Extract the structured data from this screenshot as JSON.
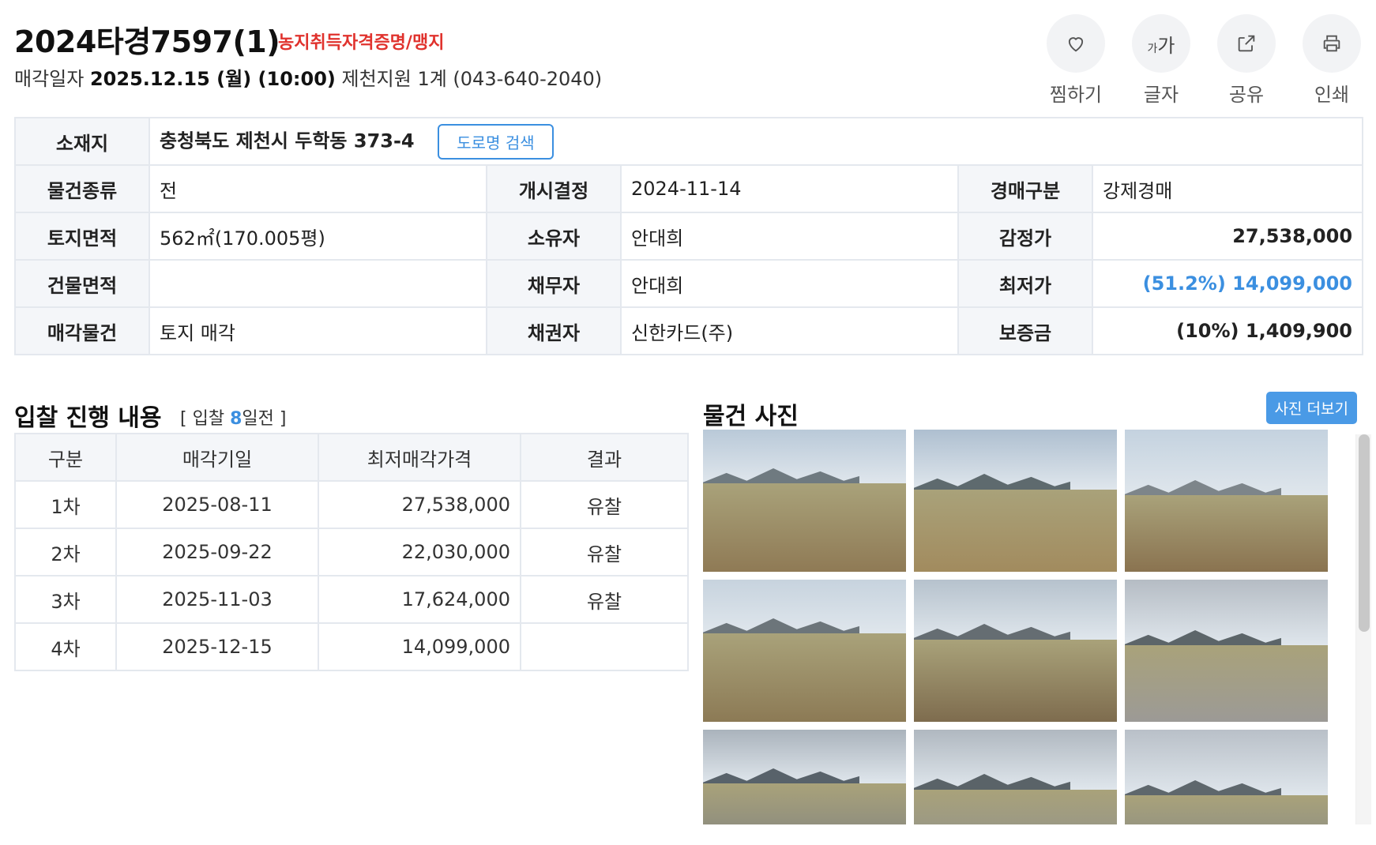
{
  "header": {
    "case_no": "2024타경7597(1)",
    "case_tag": "농지취득자격증명/맹지",
    "sale_label": "매각일자",
    "sale_date": "2025.12.15 (월) (10:00)",
    "court": "제천지원 1계 (043-640-2040)"
  },
  "actions": {
    "wish": {
      "label": "찜하기",
      "icon": "heart-icon"
    },
    "font": {
      "label": "글자",
      "icon_small": "가",
      "icon_large": "가"
    },
    "share": {
      "label": "공유",
      "icon": "share-icon"
    },
    "print": {
      "label": "인쇄",
      "icon": "print-icon"
    }
  },
  "info": {
    "location_label": "소재지",
    "location": "충청북도 제천시 두학동 373-4",
    "road_search": "도로명 검색",
    "rows": [
      {
        "l1": "물건종류",
        "v1": "전",
        "l2": "개시결정",
        "v2": "2024-11-14",
        "l3": "경매구분",
        "v3": "강제경매"
      },
      {
        "l1": "토지면적",
        "v1": "562㎡(170.005평)",
        "l2": "소유자",
        "v2": "안대희",
        "l3": "감정가",
        "v3": "27,538,000"
      },
      {
        "l1": "건물면적",
        "v1": "",
        "l2": "채무자",
        "v2": "안대희",
        "l3": "최저가",
        "v3": "(51.2%) 14,099,000"
      },
      {
        "l1": "매각물건",
        "v1": "토지 매각",
        "l2": "채권자",
        "v2": "신한카드(주)",
        "l3": "보증금",
        "v3": "(10%) 1,409,900"
      }
    ]
  },
  "bidding": {
    "title": "입찰 진행 내용",
    "sub_prefix": "[ 입찰 ",
    "sub_days": "8",
    "sub_suffix": "일전 ]",
    "headers": [
      "구분",
      "매각기일",
      "최저매각가격",
      "결과"
    ],
    "rows": [
      {
        "round": "1차",
        "date": "2025-08-11",
        "price": "27,538,000",
        "result": "유찰"
      },
      {
        "round": "2차",
        "date": "2025-09-22",
        "price": "22,030,000",
        "result": "유찰"
      },
      {
        "round": "3차",
        "date": "2025-11-03",
        "price": "17,624,000",
        "result": "유찰"
      },
      {
        "round": "4차",
        "date": "2025-12-15",
        "price": "14,099,000",
        "result": ""
      }
    ]
  },
  "photos": {
    "title": "물건 사진",
    "more": "사진 더보기",
    "items": [
      {
        "name": "photo-field-1",
        "sky": "#b9c9d8",
        "mnt": "#6f7a80",
        "field": "#8f7a55"
      },
      {
        "name": "photo-field-2",
        "sky": "#aebfd0",
        "mnt": "#5e6a6e",
        "field": "#a28b5e"
      },
      {
        "name": "photo-field-3",
        "sky": "#c4d2df",
        "mnt": "#7d858a",
        "field": "#8a7350"
      },
      {
        "name": "photo-field-4",
        "sky": "#c7d3de",
        "mnt": "#6c757a",
        "field": "#8c7a55"
      },
      {
        "name": "photo-field-5",
        "sky": "#b6c2cd",
        "mnt": "#656d72",
        "field": "#7e6c4e"
      },
      {
        "name": "photo-field-6",
        "sky": "#b5bcc4",
        "mnt": "#5c6569",
        "field": "#9c9a96"
      },
      {
        "name": "photo-field-7",
        "sky": "#aab3bc",
        "mnt": "#58626a",
        "field": "#777c82"
      },
      {
        "name": "photo-field-8",
        "sky": "#b0b8c0",
        "mnt": "#5a6368",
        "field": "#8a8d90"
      },
      {
        "name": "photo-field-9",
        "sky": "#b9c0c8",
        "mnt": "#5e676c",
        "field": "#7e8488"
      }
    ]
  }
}
